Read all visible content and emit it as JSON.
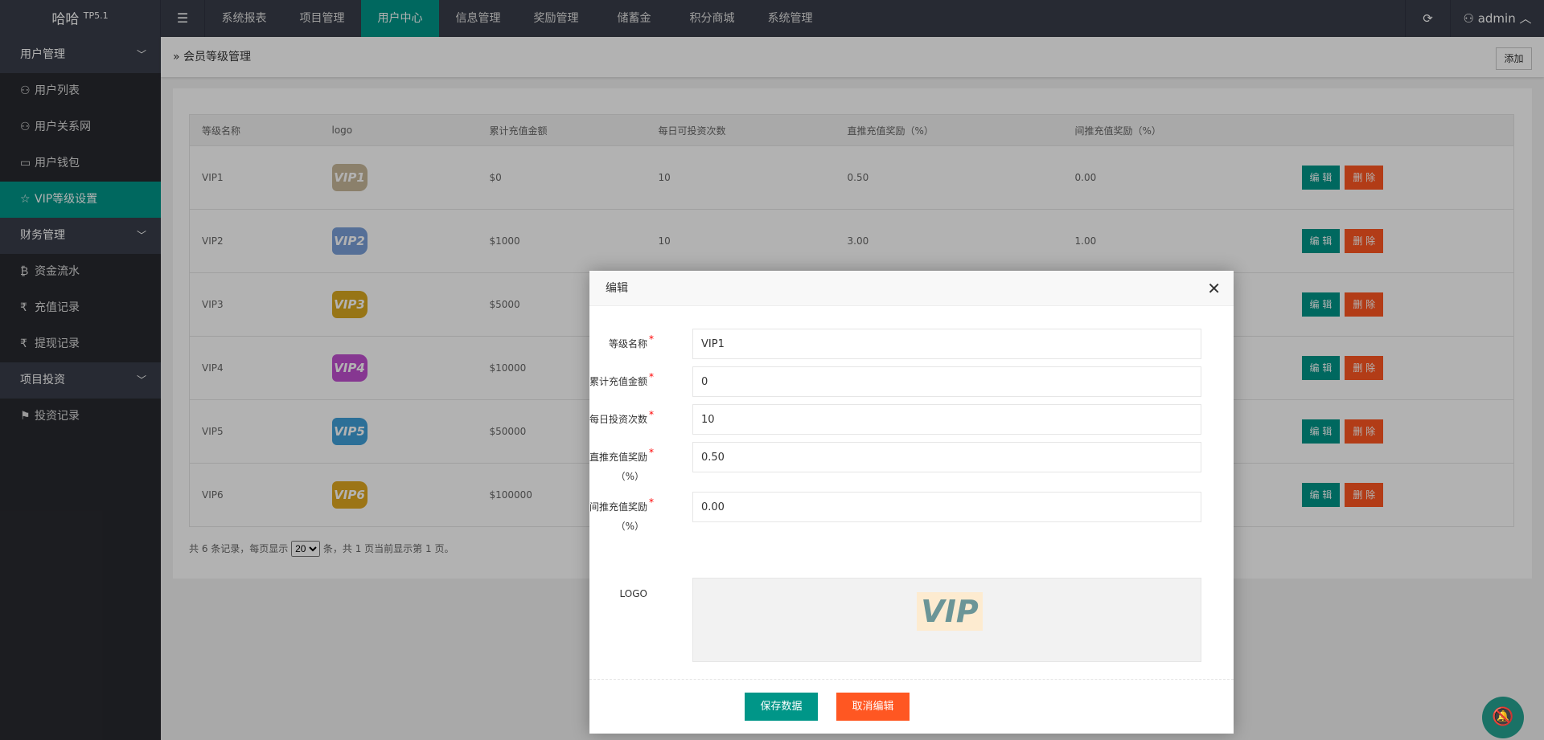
{
  "header": {
    "logo": "哈哈",
    "version": "TP5.1",
    "nav": [
      "系统报表",
      "项目管理",
      "用户中心",
      "信息管理",
      "奖励管理",
      "储蓄金",
      "积分商城",
      "系统管理"
    ],
    "active_nav": 2,
    "user": "admin"
  },
  "sidebar": {
    "groups": [
      {
        "label": "用户管理",
        "items": [
          {
            "label": "用户列表",
            "icon": "user-icon"
          },
          {
            "label": "用户关系网",
            "icon": "users-icon"
          },
          {
            "label": "用户钱包",
            "icon": "wallet-icon"
          },
          {
            "label": "VIP等级设置",
            "icon": "star-icon"
          }
        ]
      },
      {
        "label": "财务管理",
        "items": [
          {
            "label": "资金流水",
            "icon": "bitcoin-icon"
          },
          {
            "label": "充值记录",
            "icon": "rupee-icon"
          },
          {
            "label": "提现记录",
            "icon": "rupee-icon"
          }
        ]
      },
      {
        "label": "项目投资",
        "items": [
          {
            "label": "投资记录",
            "icon": "flag-icon"
          }
        ]
      }
    ]
  },
  "breadcrumb": {
    "title": "会员等级管理",
    "add_label": "添加"
  },
  "table": {
    "headers": [
      "等级名称",
      "logo",
      "累计充值金额",
      "每日可投资次数",
      "直推充值奖励（%）",
      "间推充值奖励（%）"
    ],
    "rows": [
      {
        "name": "VIP1",
        "logo": "VIP1",
        "color": "#c8b89a",
        "amount": "$0",
        "times": "10",
        "direct": "0.50",
        "indirect": "0.00"
      },
      {
        "name": "VIP2",
        "logo": "VIP2",
        "color": "#7aa0d8",
        "amount": "$1000",
        "times": "10",
        "direct": "3.00",
        "indirect": "1.00"
      },
      {
        "name": "VIP3",
        "logo": "VIP3",
        "color": "#d8a820",
        "amount": "$5000"
      },
      {
        "name": "VIP4",
        "logo": "VIP4",
        "color": "#c050d0",
        "amount": "$10000"
      },
      {
        "name": "VIP5",
        "logo": "VIP5",
        "color": "#3fa0d8",
        "amount": "$50000"
      },
      {
        "name": "VIP6",
        "logo": "VIP6",
        "color": "#e0a820",
        "amount": "$100000"
      }
    ],
    "edit_label": "编 辑",
    "delete_label": "删 除"
  },
  "pager": {
    "before": "共 6 条记录，每页显示",
    "per_page": "20",
    "after": "条，共 1 页当前显示第 1 页。"
  },
  "modal": {
    "title": "编辑",
    "fields": [
      {
        "label": "等级名称",
        "value": "VIP1"
      },
      {
        "label": "累计充值金额",
        "value": "0"
      },
      {
        "label": "每日投资次数",
        "value": "10"
      },
      {
        "label": "直推充值奖励",
        "label2": "（%）",
        "value": "0.50"
      },
      {
        "label": "间推充值奖励",
        "label2": "（%）",
        "value": "0.00"
      }
    ],
    "logo_label": "LOGO",
    "logo_text": "VIP",
    "save": "保存数据",
    "cancel": "取消编辑",
    "required": "*"
  },
  "colors": {
    "accent": "#009688",
    "danger": "#ff5722",
    "topbar": "#393d49"
  }
}
